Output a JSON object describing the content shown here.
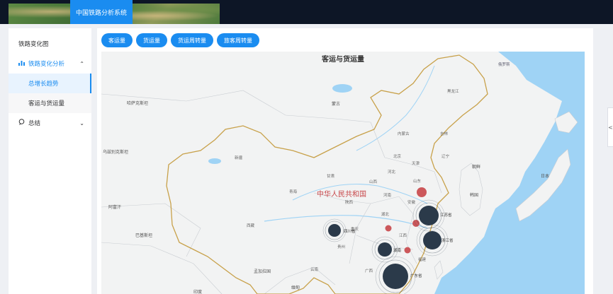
{
  "header": {
    "title": "中国铁路分析系统"
  },
  "sidebar": {
    "items": [
      {
        "label": "铁路变化图"
      },
      {
        "label": "铁路变化分析",
        "sub": [
          {
            "label": "总增长趋势"
          },
          {
            "label": "客运与货运量"
          }
        ]
      },
      {
        "label": "总结"
      }
    ]
  },
  "toolbar": {
    "buttons": [
      {
        "label": "客运量"
      },
      {
        "label": "货运量"
      },
      {
        "label": "货运周转量"
      },
      {
        "label": "旅客周转量"
      }
    ]
  },
  "map": {
    "title": "客运与货运量",
    "country_label": "中华人民共和国",
    "labels": {
      "mongolia": "蒙古",
      "kazakhstan": "哈萨克斯坦",
      "uzbekistan": "乌兹别克斯坦",
      "afghanistan": "阿富汗",
      "pakistan": "巴基斯坦",
      "xinjiang": "新疆",
      "tibet": "西藏",
      "qinghai": "青海",
      "gansu": "甘肃",
      "innermongolia": "内蒙古",
      "korea_n": "朝鲜",
      "korea_s": "韩国",
      "japan": "日本",
      "bangladesh": "孟加拉国",
      "myanmar": "缅甸",
      "india": "印度",
      "sichuan": "四川省",
      "hunan": "湖南",
      "jiangsu": "江苏省",
      "zhejiang": "浙江省",
      "guangdong": "广东省",
      "shandong": "山东",
      "henan": "河南",
      "hubei": "湖北",
      "guizhou": "贵州",
      "guangxi": "广西",
      "yunnan": "云南",
      "fujian": "福建",
      "jiangxi": "江西",
      "anhui": "安徽",
      "hebei": "河北",
      "shanxi": "山西",
      "shaanxi": "陕西",
      "chongqing": "重庆",
      "liaoning": "辽宁",
      "jilin": "吉林",
      "heilongjiang": "黑龙江",
      "beijing": "北京",
      "tianjin": "天津",
      "russia": "俄罗斯"
    },
    "colors": {
      "sea": "#9fd3f5",
      "land": "#f2f3f3",
      "border": "#c8a14a",
      "dark_bubble": "#2b3a4a",
      "red_bubble": "#c8474a"
    }
  },
  "right_handle": {
    "label": "<"
  }
}
